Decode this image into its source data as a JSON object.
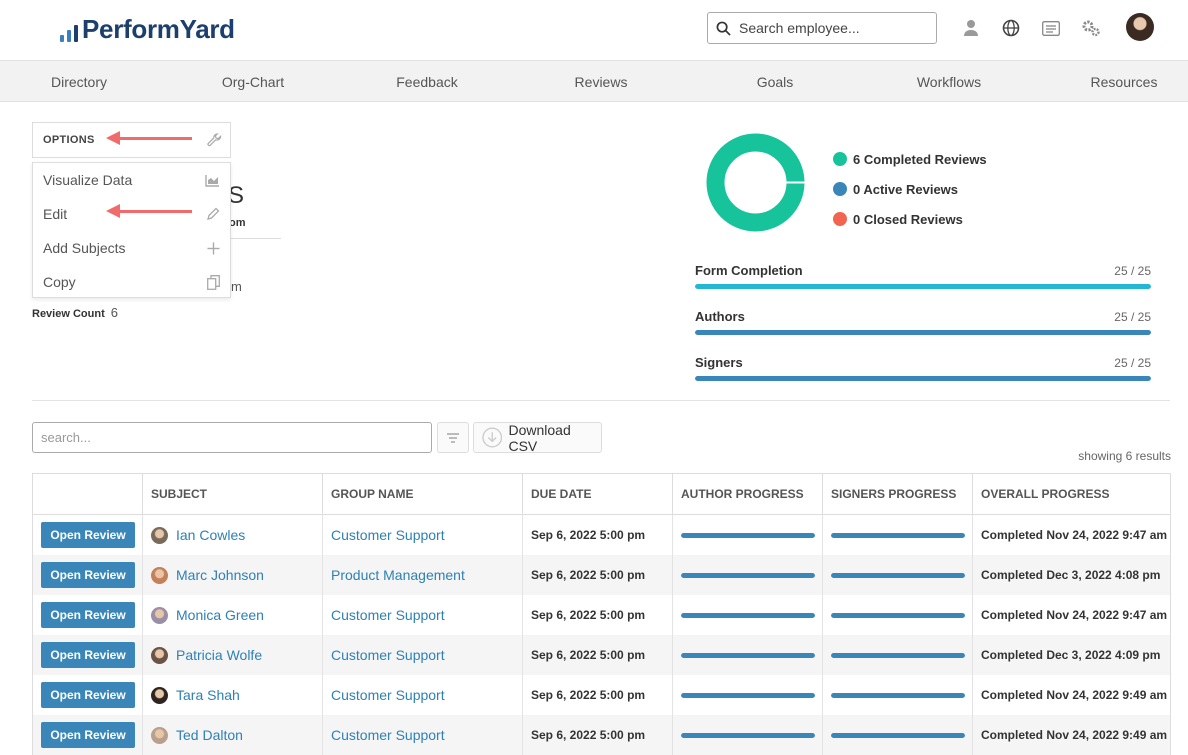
{
  "brand": {
    "name": "PerformYard"
  },
  "header": {
    "search_placeholder": "Search employee...",
    "icons": [
      "user-icon",
      "globe-icon",
      "list-icon",
      "settings-icon",
      "avatar"
    ]
  },
  "nav": [
    "Directory",
    "Org-Chart",
    "Feedback",
    "Reviews",
    "Goals",
    "Workflows",
    "Resources"
  ],
  "options": {
    "title": "OPTIONS",
    "items": [
      {
        "label": "Visualize Data",
        "icon": "chart-icon"
      },
      {
        "label": "Edit",
        "icon": "pencil-icon"
      },
      {
        "label": "Add Subjects",
        "icon": "plus-icon"
      },
      {
        "label": "Copy",
        "icon": "copy-icon"
      }
    ]
  },
  "background": {
    "title_fragment": "S",
    "subtitle_fragment": "om",
    "line_fragment": "m"
  },
  "review_count": {
    "label": "Review Count",
    "value": "6"
  },
  "summary": {
    "legend": [
      {
        "label": "6 Completed Reviews",
        "value": 6,
        "color": "#17c39a"
      },
      {
        "label": "0 Active Reviews",
        "value": 0,
        "color": "#3a86b8"
      },
      {
        "label": "0 Closed Reviews",
        "value": 0,
        "color": "#f2644f"
      }
    ],
    "progress": [
      {
        "label": "Form Completion",
        "count": "25 / 25",
        "fraction": 1.0,
        "color": "#23b7d3"
      },
      {
        "label": "Authors",
        "count": "25 / 25",
        "fraction": 1.0,
        "color": "#3a86b8"
      },
      {
        "label": "Signers",
        "count": "25 / 25",
        "fraction": 1.0,
        "color": "#3a86b8"
      }
    ]
  },
  "table_controls": {
    "search_placeholder": "search...",
    "download_label": "Download CSV",
    "results_text": "showing 6 results"
  },
  "table": {
    "columns": [
      "",
      "SUBJECT",
      "GROUP NAME",
      "DUE DATE",
      "AUTHOR PROGRESS",
      "SIGNERS PROGRESS",
      "OVERALL PROGRESS"
    ],
    "open_label": "Open Review",
    "rows": [
      {
        "subject": "Ian Cowles",
        "group": "Customer Support",
        "due": "Sep 6, 2022 5:00 pm",
        "author_progress": 1.0,
        "signers_progress": 1.0,
        "overall": "Completed Nov 24, 2022 9:47 am",
        "avatar_color": "#7a6a5c"
      },
      {
        "subject": "Marc Johnson",
        "group": "Product Management",
        "due": "Sep 6, 2022 5:00 pm",
        "author_progress": 1.0,
        "signers_progress": 1.0,
        "overall": "Completed Dec 3, 2022 4:08 pm",
        "avatar_color": "#c77e5a"
      },
      {
        "subject": "Monica Green",
        "group": "Customer Support",
        "due": "Sep 6, 2022 5:00 pm",
        "author_progress": 1.0,
        "signers_progress": 1.0,
        "overall": "Completed Nov 24, 2022 9:47 am",
        "avatar_color": "#9a8fa6"
      },
      {
        "subject": "Patricia Wolfe",
        "group": "Customer Support",
        "due": "Sep 6, 2022 5:00 pm",
        "author_progress": 1.0,
        "signers_progress": 1.0,
        "overall": "Completed Dec 3, 2022 4:09 pm",
        "avatar_color": "#6b5446"
      },
      {
        "subject": "Tara Shah",
        "group": "Customer Support",
        "due": "Sep 6, 2022 5:00 pm",
        "author_progress": 1.0,
        "signers_progress": 1.0,
        "overall": "Completed Nov 24, 2022 9:49 am",
        "avatar_color": "#2e2520"
      },
      {
        "subject": "Ted Dalton",
        "group": "Customer Support",
        "due": "Sep 6, 2022 5:00 pm",
        "author_progress": 1.0,
        "signers_progress": 1.0,
        "overall": "Completed Nov 24, 2022 9:49 am",
        "avatar_color": "#b9a08c"
      }
    ]
  }
}
